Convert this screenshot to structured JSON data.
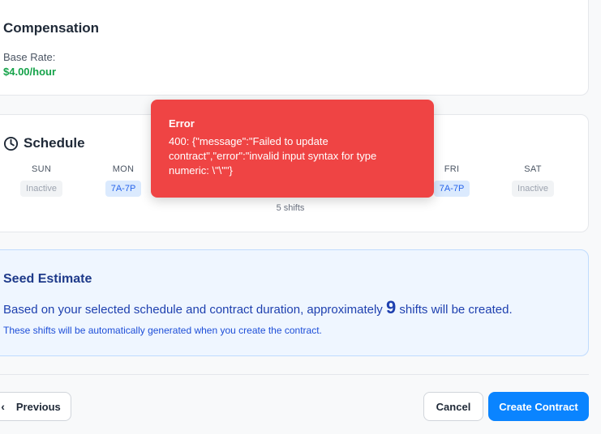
{
  "compensation": {
    "title": "Compensation",
    "base_rate_label": "Base Rate:",
    "base_rate_value": "$4.00/hour"
  },
  "schedule": {
    "title": "Schedule",
    "days": [
      {
        "name": "SUN",
        "status": "Inactive",
        "active": false
      },
      {
        "name": "MON",
        "status": "7A-7P",
        "active": true
      },
      {
        "name": "FRI",
        "status": "7A-7P",
        "active": true
      },
      {
        "name": "SAT",
        "status": "Inactive",
        "active": false
      }
    ],
    "shift_count": "5 shifts"
  },
  "seed_estimate": {
    "title": "Seed Estimate",
    "line_prefix": "Based on your selected schedule and contract duration, approximately",
    "count": "9",
    "line_suffix": "shifts will be created.",
    "sub": "These shifts will be automatically generated when you create the contract."
  },
  "footer": {
    "previous_label": "Previous",
    "cancel_label": "Cancel",
    "create_label": "Create Contract"
  },
  "toast": {
    "title": "Error",
    "message": "400: {\"message\":\"Failed to update contract\",\"error\":\"invalid input syntax for type numeric: \\\"\\\"\"}"
  },
  "colors": {
    "accent": "#0a84ff",
    "error": "#ef4444",
    "rate": "#16a34a"
  }
}
